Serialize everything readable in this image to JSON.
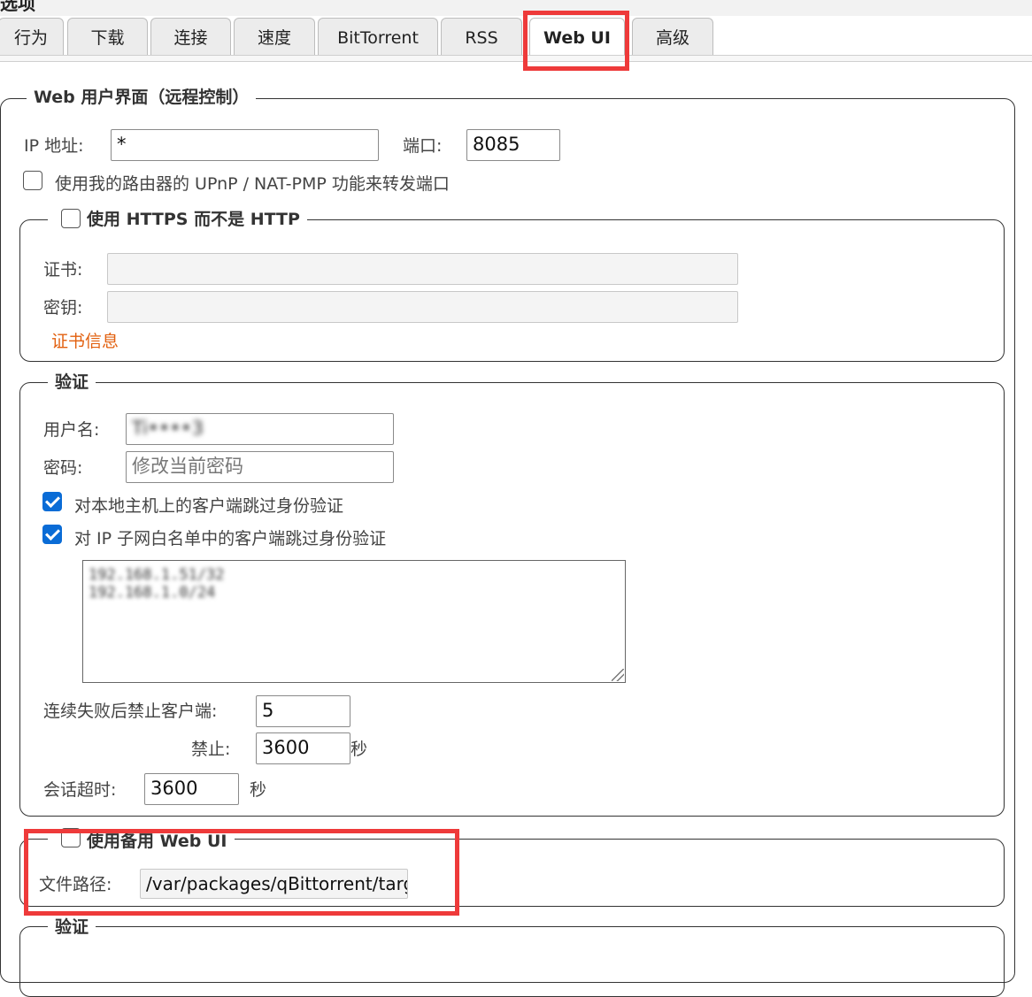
{
  "window": {
    "title": "选项"
  },
  "tabs": [
    {
      "label": "行为"
    },
    {
      "label": "下载"
    },
    {
      "label": "连接"
    },
    {
      "label": "速度"
    },
    {
      "label": "BitTorrent"
    },
    {
      "label": "RSS"
    },
    {
      "label": "Web UI"
    },
    {
      "label": "高级"
    }
  ],
  "webui": {
    "legend": "Web 用户界面（远程控制）",
    "ip_label": "IP 地址:",
    "ip_value": "*",
    "port_label": "端口:",
    "port_value": "8085",
    "upnp_label": "使用我的路由器的 UPnP / NAT-PMP 功能来转发端口"
  },
  "https": {
    "legend": "使用 HTTPS 而不是 HTTP",
    "cert_label": "证书:",
    "key_label": "密钥:",
    "cert_info_link": "证书信息"
  },
  "auth": {
    "legend": "验证",
    "username_label": "用户名:",
    "username_value": "Ti••••3",
    "password_label": "密码:",
    "password_placeholder": "修改当前密码",
    "bypass_local_label": "对本地主机上的客户端跳过身份验证",
    "bypass_subnet_label": "对 IP 子网白名单中的客户端跳过身份验证",
    "subnet_lines": [
      "192.168.1.51/32",
      "192.168.1.0/24"
    ],
    "ban_after_label": "连续失败后禁止客户端:",
    "ban_after_value": "5",
    "ban_label": "禁止:",
    "ban_value": "3600",
    "ban_unit": "秒",
    "session_label": "会话超时:",
    "session_value": "3600",
    "session_unit": "秒"
  },
  "alt_webui": {
    "legend": "使用备用 Web UI",
    "path_label": "文件路径:",
    "path_value": "/var/packages/qBittorrent/target"
  },
  "auth2": {
    "legend": "验证"
  },
  "colors": {
    "accent": "#0a6cd6",
    "highlight": "#ee3a3a",
    "link": "#e2600f"
  }
}
